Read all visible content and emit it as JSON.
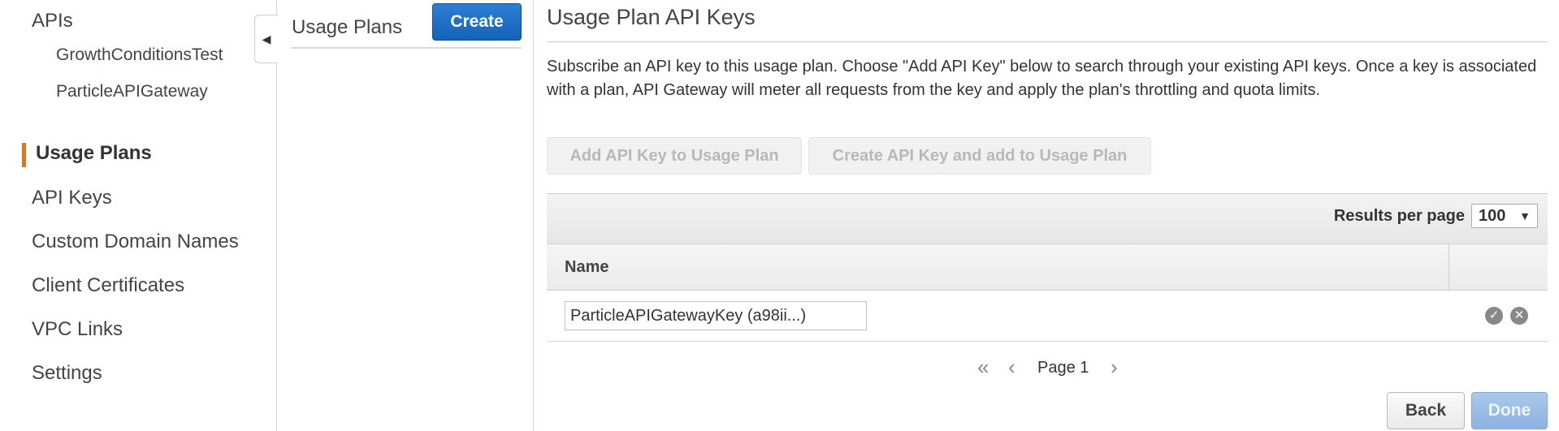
{
  "nav": {
    "items": [
      {
        "label": "APIs"
      },
      {
        "label": "GrowthConditionsTest"
      },
      {
        "label": "ParticleAPIGateway"
      },
      {
        "label": "Usage Plans"
      },
      {
        "label": "API Keys"
      },
      {
        "label": "Custom Domain Names"
      },
      {
        "label": "Client Certificates"
      },
      {
        "label": "VPC Links"
      },
      {
        "label": "Settings"
      }
    ],
    "active_color": "#ec7211",
    "collapse_icon": "chevron-left-icon"
  },
  "middle": {
    "title": "Usage Plans",
    "create_label": "Create"
  },
  "main": {
    "title": "Usage Plan API Keys",
    "description": "Subscribe an API key to this usage plan. Choose \"Add API Key\" below to search through your existing API keys. Once a key is associated with a plan, API Gateway will meter all requests from the key and apply the plan's throttling and quota limits.",
    "add_key_label": "Add API Key to Usage Plan",
    "create_key_label": "Create API Key and add to Usage Plan",
    "table": {
      "results_per_page_label": "Results per page",
      "results_per_page_value": "100",
      "column_name": "Name",
      "rows": [
        {
          "name": "ParticleAPIGatewayKey (a98ii...)",
          "confirm_icon": "check-circle-icon",
          "cancel_icon": "x-circle-icon"
        }
      ]
    },
    "pager": {
      "page_label": "Page 1",
      "first_icon": "double-chevron-left-icon",
      "prev_icon": "chevron-left-icon",
      "next_icon": "chevron-right-icon"
    },
    "back_label": "Back",
    "done_label": "Done"
  },
  "colors": {
    "primary_button": "#1562b6",
    "accent": "#ec7211"
  }
}
